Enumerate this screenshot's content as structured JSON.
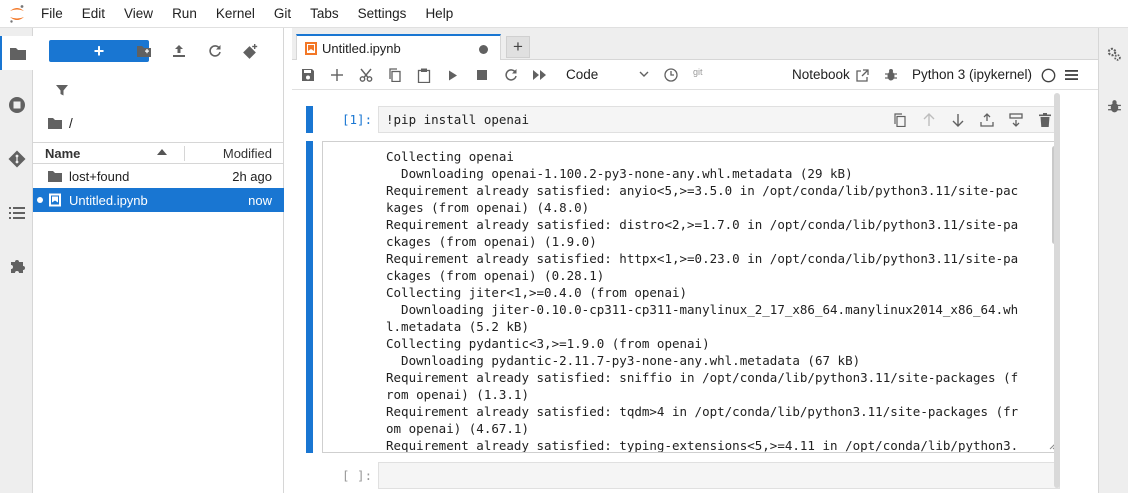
{
  "menu": [
    "File",
    "Edit",
    "View",
    "Run",
    "Kernel",
    "Git",
    "Tabs",
    "Settings",
    "Help"
  ],
  "filebrowser": {
    "new_label": "+",
    "breadcrumb": "/",
    "header": {
      "name": "Name",
      "modified": "Modified"
    },
    "files": [
      {
        "name": "lost+found",
        "modified": "2h ago",
        "type": "folder",
        "selected": false
      },
      {
        "name": "Untitled.ipynb",
        "modified": "now",
        "type": "notebook",
        "selected": true
      }
    ]
  },
  "tabs": [
    {
      "label": "Untitled.ipynb",
      "dirty": true
    }
  ],
  "toolbar": {
    "cell_type": "Code",
    "git_label": "git",
    "notebook_label": "Notebook",
    "kernel_label": "Python 3 (ipykernel)"
  },
  "cells": [
    {
      "prompt": "[1]:",
      "source": "!pip install openai",
      "output": [
        "Collecting openai",
        "  Downloading openai-1.100.2-py3-none-any.whl.metadata (29 kB)",
        "Requirement already satisfied: anyio<5,>=3.5.0 in /opt/conda/lib/python3.11/site-pac",
        "kages (from openai) (4.8.0)",
        "Requirement already satisfied: distro<2,>=1.7.0 in /opt/conda/lib/python3.11/site-pa",
        "ckages (from openai) (1.9.0)",
        "Requirement already satisfied: httpx<1,>=0.23.0 in /opt/conda/lib/python3.11/site-pa",
        "ckages (from openai) (0.28.1)",
        "Collecting jiter<1,>=0.4.0 (from openai)",
        "  Downloading jiter-0.10.0-cp311-cp311-manylinux_2_17_x86_64.manylinux2014_x86_64.wh",
        "l.metadata (5.2 kB)",
        "Collecting pydantic<3,>=1.9.0 (from openai)",
        "  Downloading pydantic-2.11.7-py3-none-any.whl.metadata (67 kB)",
        "Requirement already satisfied: sniffio in /opt/conda/lib/python3.11/site-packages (f",
        "rom openai) (1.3.1)",
        "Requirement already satisfied: tqdm>4 in /opt/conda/lib/python3.11/site-packages (fr",
        "om openai) (4.67.1)",
        "Requirement already satisfied: typing-extensions<5,>=4.11 in /opt/conda/lib/python3."
      ]
    },
    {
      "prompt": "[ ]:",
      "source": ""
    }
  ],
  "colors": {
    "accent": "#1976d2",
    "sidebar_bg": "#eeeeee"
  }
}
